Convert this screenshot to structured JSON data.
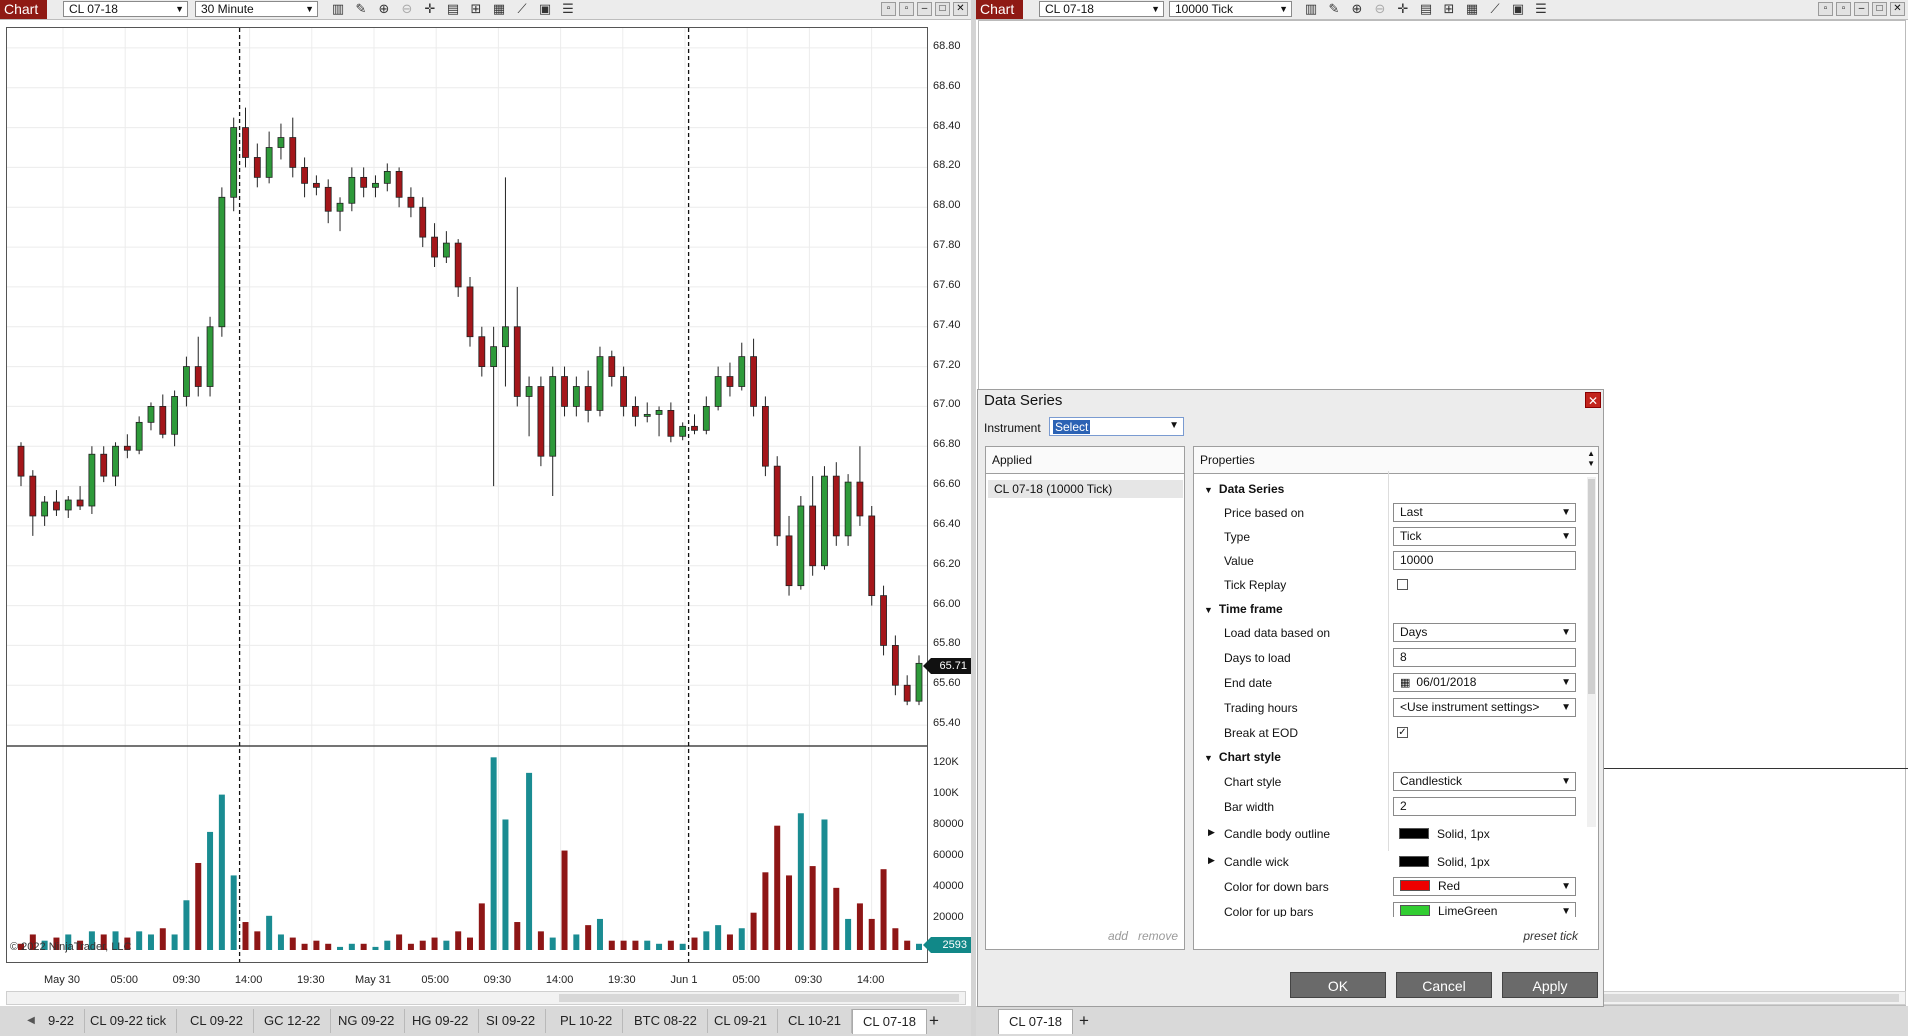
{
  "left": {
    "chart_button": "Chart",
    "instrument": "CL 07-18",
    "interval": "30 Minute",
    "y_axis_labels": [
      "68.80",
      "68.60",
      "68.40",
      "68.20",
      "68.00",
      "67.80",
      "67.60",
      "67.40",
      "67.20",
      "67.00",
      "66.80",
      "66.60",
      "66.40",
      "66.20",
      "66.00",
      "65.80",
      "65.60",
      "65.40"
    ],
    "volume_axis_labels": [
      "120K",
      "100K",
      "80000",
      "60000",
      "40000",
      "20000"
    ],
    "x_axis_labels": [
      "May 30",
      "05:00",
      "09:30",
      "14:00",
      "19:30",
      "May 31",
      "05:00",
      "09:30",
      "14:00",
      "19:30",
      "Jun 1",
      "05:00",
      "09:30",
      "14:00"
    ],
    "last_price": "65.71",
    "last_volume": "2593",
    "copyright": "© 2022 NinjaTrader, LLC",
    "tabs": [
      "9-22",
      "CL 09-22 tick",
      "CL 09-22",
      "GC 12-22",
      "NG 09-22",
      "HG 09-22",
      "SI 09-22",
      "PL 10-22",
      "BTC 08-22",
      "CL 09-21",
      "CL 10-21",
      "CL 07-18"
    ],
    "active_tab": "CL 07-18"
  },
  "right": {
    "chart_button": "Chart",
    "instrument": "CL 07-18",
    "interval": "10000 Tick",
    "tab": "CL 07-18"
  },
  "colors": {
    "up": "#2e9a3a",
    "down": "#a4161a",
    "volume_up": "#1a8c92",
    "volume_down": "#8e1616",
    "chart_button": "#8f1a14"
  },
  "chart_data": {
    "type": "candlestick",
    "ylim": [
      65.3,
      68.9
    ],
    "volume_ylim": [
      0,
      130000
    ],
    "session_separators": [
      18,
      56
    ],
    "candles": [
      [
        66.8,
        66.82,
        66.6,
        66.65
      ],
      [
        66.65,
        66.68,
        66.35,
        66.45
      ],
      [
        66.45,
        66.55,
        66.4,
        66.52
      ],
      [
        66.52,
        66.58,
        66.45,
        66.48
      ],
      [
        66.48,
        66.55,
        66.44,
        66.53
      ],
      [
        66.53,
        66.6,
        66.48,
        66.5
      ],
      [
        66.5,
        66.8,
        66.46,
        66.76
      ],
      [
        66.76,
        66.8,
        66.62,
        66.65
      ],
      [
        66.65,
        66.82,
        66.6,
        66.8
      ],
      [
        66.8,
        66.86,
        66.74,
        66.78
      ],
      [
        66.78,
        66.95,
        66.76,
        66.92
      ],
      [
        66.92,
        67.02,
        66.88,
        67.0
      ],
      [
        67.0,
        67.06,
        66.84,
        66.86
      ],
      [
        66.86,
        67.08,
        66.8,
        67.05
      ],
      [
        67.05,
        67.25,
        67.0,
        67.2
      ],
      [
        67.2,
        67.35,
        67.05,
        67.1
      ],
      [
        67.1,
        67.45,
        67.05,
        67.4
      ],
      [
        67.4,
        68.1,
        67.35,
        68.05
      ],
      [
        68.05,
        68.45,
        67.98,
        68.4
      ],
      [
        68.4,
        68.5,
        68.2,
        68.25
      ],
      [
        68.25,
        68.32,
        68.1,
        68.15
      ],
      [
        68.15,
        68.38,
        68.12,
        68.3
      ],
      [
        68.3,
        68.42,
        68.24,
        68.35
      ],
      [
        68.35,
        68.45,
        68.15,
        68.2
      ],
      [
        68.2,
        68.25,
        68.05,
        68.12
      ],
      [
        68.12,
        68.16,
        68.06,
        68.1
      ],
      [
        68.1,
        68.14,
        67.92,
        67.98
      ],
      [
        67.98,
        68.05,
        67.88,
        68.02
      ],
      [
        68.02,
        68.2,
        67.98,
        68.15
      ],
      [
        68.15,
        68.2,
        68.05,
        68.1
      ],
      [
        68.1,
        68.16,
        68.05,
        68.12
      ],
      [
        68.12,
        68.22,
        68.08,
        68.18
      ],
      [
        68.18,
        68.2,
        68.0,
        68.05
      ],
      [
        68.05,
        68.1,
        67.95,
        68.0
      ],
      [
        68.0,
        68.05,
        67.8,
        67.85
      ],
      [
        67.85,
        67.92,
        67.7,
        67.75
      ],
      [
        67.75,
        67.88,
        67.72,
        67.82
      ],
      [
        67.82,
        67.84,
        67.55,
        67.6
      ],
      [
        67.6,
        67.65,
        67.3,
        67.35
      ],
      [
        67.35,
        67.4,
        67.15,
        67.2
      ],
      [
        67.2,
        67.4,
        66.6,
        67.3
      ],
      [
        67.3,
        68.15,
        67.1,
        67.4
      ],
      [
        67.4,
        67.6,
        67.0,
        67.05
      ],
      [
        67.05,
        67.15,
        66.85,
        67.1
      ],
      [
        67.1,
        67.15,
        66.7,
        66.75
      ],
      [
        66.75,
        67.2,
        66.55,
        67.15
      ],
      [
        67.15,
        67.2,
        66.95,
        67.0
      ],
      [
        67.0,
        67.15,
        66.95,
        67.1
      ],
      [
        67.1,
        67.18,
        66.92,
        66.98
      ],
      [
        66.98,
        67.3,
        66.95,
        67.25
      ],
      [
        67.25,
        67.28,
        67.1,
        67.15
      ],
      [
        67.15,
        67.2,
        66.95,
        67.0
      ],
      [
        67.0,
        67.05,
        66.9,
        66.95
      ],
      [
        66.95,
        67.02,
        66.92,
        66.96
      ],
      [
        66.96,
        67.0,
        66.85,
        66.98
      ],
      [
        66.98,
        67.02,
        66.82,
        66.85
      ],
      [
        66.85,
        66.92,
        66.83,
        66.9
      ],
      [
        66.9,
        66.96,
        66.86,
        66.88
      ],
      [
        66.88,
        67.05,
        66.86,
        67.0
      ],
      [
        67.0,
        67.2,
        66.98,
        67.15
      ],
      [
        67.15,
        67.22,
        67.05,
        67.1
      ],
      [
        67.1,
        67.32,
        67.08,
        67.25
      ],
      [
        67.25,
        67.34,
        66.95,
        67.0
      ],
      [
        67.0,
        67.05,
        66.65,
        66.7
      ],
      [
        66.7,
        66.75,
        66.3,
        66.35
      ],
      [
        66.35,
        66.45,
        66.05,
        66.1
      ],
      [
        66.1,
        66.55,
        66.08,
        66.5
      ],
      [
        66.5,
        66.65,
        66.15,
        66.2
      ],
      [
        66.2,
        66.7,
        66.18,
        66.65
      ],
      [
        66.65,
        66.72,
        66.3,
        66.35
      ],
      [
        66.35,
        66.66,
        66.3,
        66.62
      ],
      [
        66.62,
        66.8,
        66.4,
        66.45
      ],
      [
        66.45,
        66.5,
        66.0,
        66.05
      ],
      [
        66.05,
        66.1,
        65.75,
        65.8
      ],
      [
        65.8,
        65.85,
        65.55,
        65.6
      ],
      [
        65.6,
        65.65,
        65.5,
        65.52
      ],
      [
        65.52,
        65.75,
        65.5,
        65.71
      ]
    ],
    "volume_values": [
      2,
      5,
      3,
      4,
      5,
      3,
      6,
      5,
      6,
      4,
      6,
      5,
      7,
      5,
      16,
      28,
      38,
      50,
      24,
      9,
      6,
      11,
      5,
      4,
      2,
      3,
      2,
      1,
      2,
      2,
      1,
      3,
      5,
      2,
      3,
      4,
      3,
      6,
      4,
      15,
      62,
      42,
      9,
      57,
      6,
      4,
      32,
      5,
      8,
      10,
      3,
      3,
      3,
      3,
      2,
      3,
      2,
      4,
      6,
      8,
      5,
      7,
      12,
      25,
      40,
      24,
      44,
      27,
      42,
      20,
      10,
      15,
      10,
      26,
      7,
      3,
      2
    ]
  },
  "dialog": {
    "title": "Data Series",
    "close": "✕",
    "instrument_label": "Instrument",
    "instrument_value": "Select",
    "applied_header": "Applied",
    "applied_item": "CL 07-18 (10000 Tick)",
    "add": "add",
    "remove": "remove",
    "properties_header": "Properties",
    "preset": "preset tick",
    "sections": {
      "data_series": "Data Series",
      "time_frame": "Time frame",
      "chart_style": "Chart style"
    },
    "props": {
      "price_based_on": {
        "label": "Price based on",
        "value": "Last"
      },
      "type": {
        "label": "Type",
        "value": "Tick"
      },
      "value": {
        "label": "Value",
        "value": "10000"
      },
      "tick_replay": {
        "label": "Tick Replay"
      },
      "load_data": {
        "label": "Load data based on",
        "value": "Days"
      },
      "days_to_load": {
        "label": "Days to load",
        "value": "8"
      },
      "end_date": {
        "label": "End date",
        "value": "06/01/2018"
      },
      "trading_hours": {
        "label": "Trading hours",
        "value": "<Use instrument settings>"
      },
      "break_at_eod": {
        "label": "Break at EOD"
      },
      "chart_style": {
        "label": "Chart style",
        "value": "Candlestick"
      },
      "bar_width": {
        "label": "Bar width",
        "value": "2"
      },
      "candle_body_outline": {
        "label": "Candle body outline",
        "value": "Solid, 1px"
      },
      "candle_wick": {
        "label": "Candle wick",
        "value": "Solid, 1px"
      },
      "color_down": {
        "label": "Color for down bars",
        "value": "Red"
      },
      "color_up": {
        "label": "Color for up bars",
        "value": "LimeGreen"
      }
    },
    "buttons": {
      "ok": "OK",
      "cancel": "Cancel",
      "apply": "Apply"
    }
  }
}
